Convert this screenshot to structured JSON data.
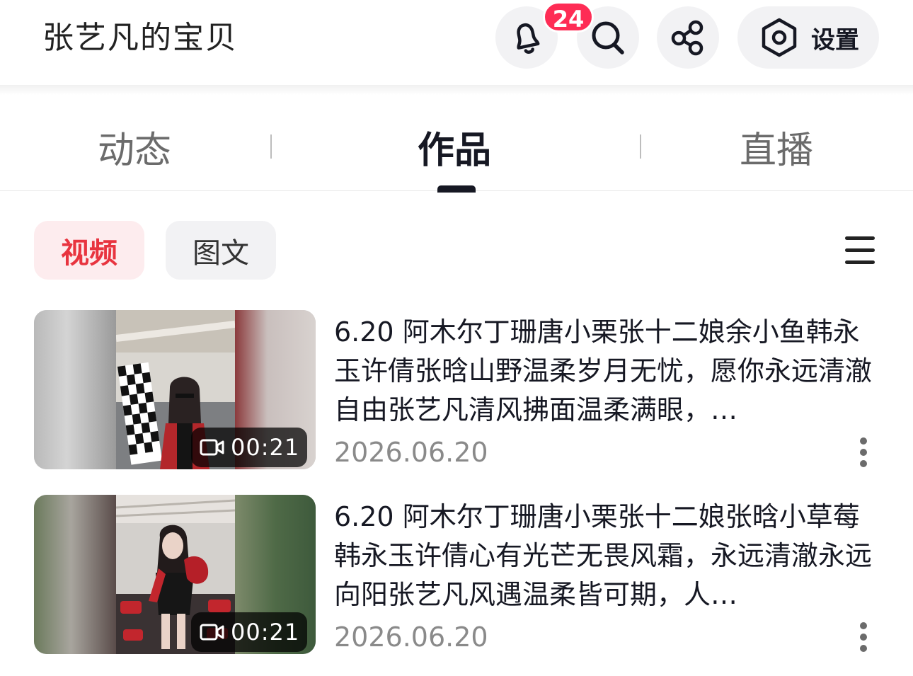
{
  "header": {
    "title": "张艺凡的宝贝",
    "notification_count": "24",
    "settings_label": "设置",
    "icons": [
      "bell-icon",
      "search-icon",
      "share-icon",
      "settings-icon"
    ]
  },
  "tabs": [
    {
      "label": "动态",
      "active": false
    },
    {
      "label": "作品",
      "active": true
    },
    {
      "label": "直播",
      "active": false
    }
  ],
  "filters": {
    "video_label": "视频",
    "text_label": "图文",
    "selected": "视频"
  },
  "posts": [
    {
      "description": "6.20 阿木尔丁珊唐小栗张十二娘余小鱼韩永玉许倩张晗山野温柔岁月无忧，愿你永远清澈自由张艺凡清风拂面温柔满眼，…",
      "date": "2026.06.20",
      "duration": "00:21"
    },
    {
      "description": "6.20 阿木尔丁珊唐小栗张十二娘张晗小草莓韩永玉许倩心有光芒无畏风霜，永远清澈永远向阳张艺凡风遇温柔皆可期，人…",
      "date": "2026.06.20",
      "duration": "00:21"
    }
  ],
  "colors": {
    "accent": "#fe2c55",
    "chip_active_text": "#e8343f",
    "chip_active_bg": "#fdecee"
  }
}
